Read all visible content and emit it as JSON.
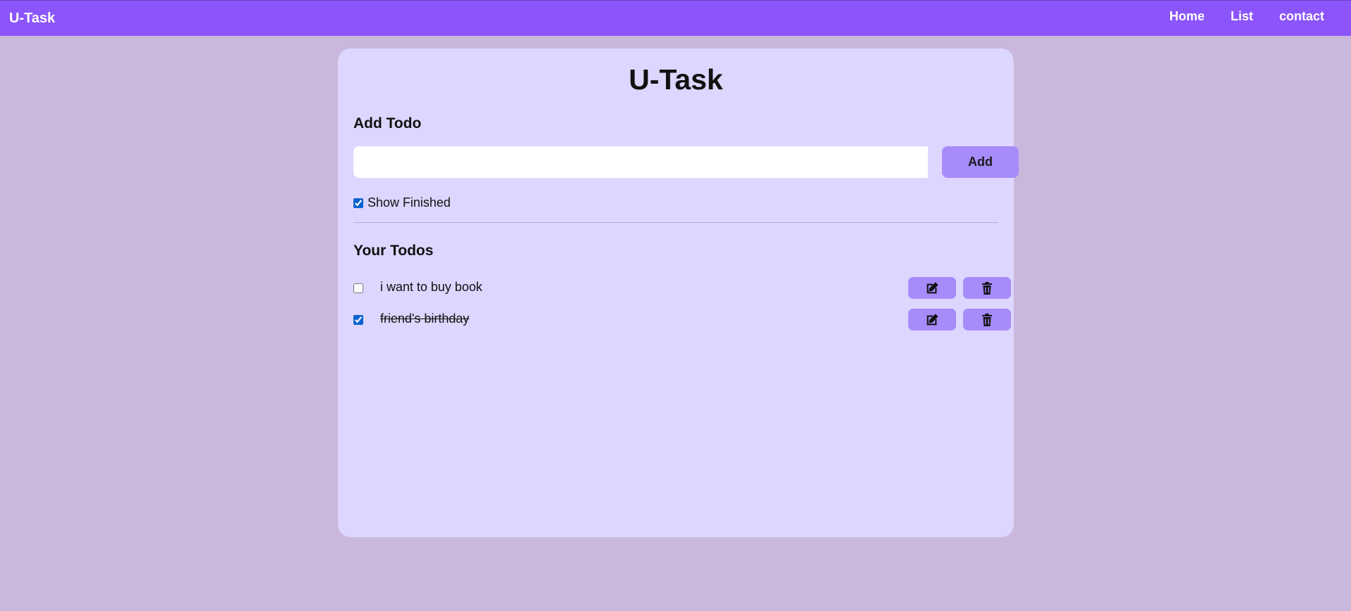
{
  "navbar": {
    "brand": "U-Task",
    "links": [
      "Home",
      "List",
      "contact"
    ]
  },
  "main": {
    "title": "U-Task",
    "add_heading": "Add Todo",
    "input": {
      "value": "",
      "placeholder": ""
    },
    "add_label": "Add",
    "show_finished_label": "Show Finished",
    "show_finished_checked": true,
    "todos_heading": "Your Todos",
    "todos": [
      {
        "text": "i want to buy book",
        "completed": false,
        "edit_icon": "edit-icon",
        "delete_icon": "trash-icon"
      },
      {
        "text": "friend's birthday",
        "completed": true,
        "edit_icon": "edit-icon",
        "delete_icon": "trash-icon"
      }
    ]
  },
  "colors": {
    "navbar": "#8b55fb",
    "page_background": "#c9b7dc",
    "card_background": "#ddd6fe",
    "button": "#a78bfa"
  }
}
